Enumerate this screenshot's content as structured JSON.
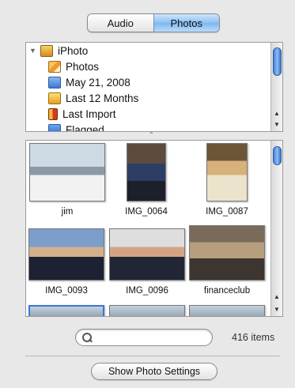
{
  "segmented": {
    "audio_label": "Audio",
    "photos_label": "Photos",
    "selected": "Photos"
  },
  "source_list": {
    "items": [
      {
        "label": "iPhoto",
        "icon": "iphoto-icon"
      },
      {
        "label": "Photos",
        "icon": "photos-icon"
      },
      {
        "label": "May 21, 2008",
        "icon": "event-icon"
      },
      {
        "label": "Last 12 Months",
        "icon": "calendar-icon"
      },
      {
        "label": "Last Import",
        "icon": "import-icon"
      },
      {
        "label": "Flagged",
        "icon": "flag-icon"
      }
    ]
  },
  "photos": [
    {
      "caption": "jim"
    },
    {
      "caption": "IMG_0064"
    },
    {
      "caption": "IMG_0087"
    },
    {
      "caption": "IMG_0093"
    },
    {
      "caption": "IMG_0096"
    },
    {
      "caption": "financeclub"
    }
  ],
  "search": {
    "value": "",
    "placeholder": ""
  },
  "item_count": "416 items",
  "settings_button": "Show Photo Settings",
  "colors": {
    "accent": "#7fb7f0",
    "background": "#e8e8e8"
  }
}
